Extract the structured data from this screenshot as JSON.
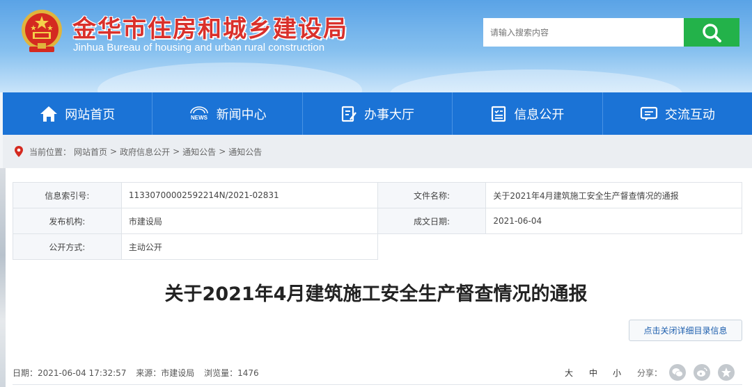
{
  "header": {
    "title": "金华市住房和城乡建设局",
    "subtitle": "Jinhua Bureau of housing and urban rural construction",
    "search_placeholder": "请输入搜索内容"
  },
  "nav": {
    "items": [
      {
        "label": "网站首页",
        "icon": "home-icon"
      },
      {
        "label": "新闻中心",
        "icon": "news-icon"
      },
      {
        "label": "办事大厅",
        "icon": "service-icon"
      },
      {
        "label": "信息公开",
        "icon": "info-icon"
      },
      {
        "label": "交流互动",
        "icon": "chat-icon"
      }
    ]
  },
  "breadcrumb": {
    "prefix": "当前位置：",
    "items": [
      "网站首页",
      ">",
      "政府信息公开",
      ">",
      "通知公告",
      ">",
      "通知公告"
    ]
  },
  "info": {
    "index_label": "信息索引号:",
    "index_value": "11330700002592214N/2021-02831",
    "filename_label": "文件名称:",
    "filename_value": "关于2021年4月建筑施工安全生产督查情况的通报",
    "publisher_label": "发布机构:",
    "publisher_value": "市建设局",
    "date_label": "成文日期:",
    "date_value": "2021-06-04",
    "method_label": "公开方式:",
    "method_value": "主动公开"
  },
  "article": {
    "title": "关于2021年4月建筑施工安全生产督查情况的通报",
    "toggle_label": "点击关闭详细目录信息",
    "meta_date": "日期：2021-06-04 17:32:57",
    "meta_source": "来源：市建设局",
    "meta_views": "浏览量：1476",
    "font_large": "大",
    "font_medium": "中",
    "font_small": "小",
    "share_label": "分享："
  },
  "colors": {
    "nav_bg": "#1b73d6",
    "search_btn": "#23b24a",
    "title_red": "#d9302b"
  }
}
